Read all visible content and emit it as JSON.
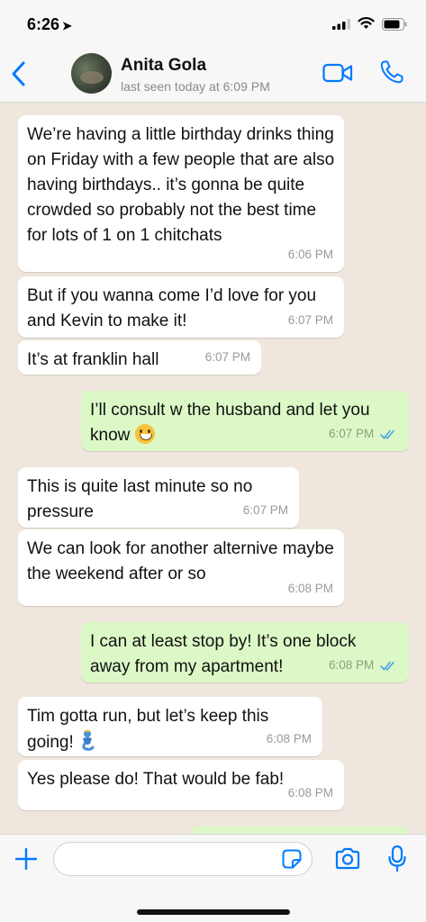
{
  "status_bar": {
    "time": "6:26",
    "location_arrow": "location-arrow-icon"
  },
  "header": {
    "back_icon": "chevron-left-icon",
    "contact_name": "Anita Gola",
    "last_seen": "last seen today at 6:09 PM",
    "video_icon": "video-camera-icon",
    "call_icon": "phone-icon"
  },
  "messages": [
    {
      "direction": "in",
      "text": "We’re having a little birthday drinks thing on Friday with a few people that are also having birthdays.. it’s gonna be quite crowded so probably not the best time for lots of 1 on 1 chitchats",
      "time": "6:06 PM"
    },
    {
      "direction": "in",
      "text": "But if you wanna come I’d love for you and Kevin to make it!",
      "time": "6:07 PM"
    },
    {
      "direction": "in",
      "text": "It’s at franklin hall",
      "time": "6:07 PM"
    },
    {
      "direction": "out",
      "text": "I’ll consult w the husband and let you know",
      "emoji": "grinning-face-emoji",
      "time": "6:07 PM",
      "status": "read"
    },
    {
      "direction": "in",
      "text": "This is quite last minute so no pressure",
      "time": "6:07 PM"
    },
    {
      "direction": "in",
      "text": "We can look for another alternive maybe the weekend after or so",
      "time": "6:08 PM"
    },
    {
      "direction": "out",
      "text": "I can at least stop by! It’s one block away from my apartment!",
      "time": "6:08 PM",
      "status": "read"
    },
    {
      "direction": "in",
      "text": "Tim gotta run, but let’s keep this going!",
      "emoji": "genie-emoji",
      "time": "6:08 PM"
    },
    {
      "direction": "in",
      "text": "Yes please do! That would be fab!",
      "time": "6:08 PM"
    }
  ],
  "composer": {
    "plus_icon": "plus-icon",
    "input_value": "",
    "sticker_icon": "sticker-icon",
    "camera_icon": "camera-icon",
    "mic_icon": "microphone-icon"
  },
  "colors": {
    "accent": "#007aff",
    "incoming_bubble": "#ffffff",
    "outgoing_bubble": "#dcf8c6",
    "read_ticks": "#4fa3e6",
    "chat_background": "#efe7dd"
  }
}
